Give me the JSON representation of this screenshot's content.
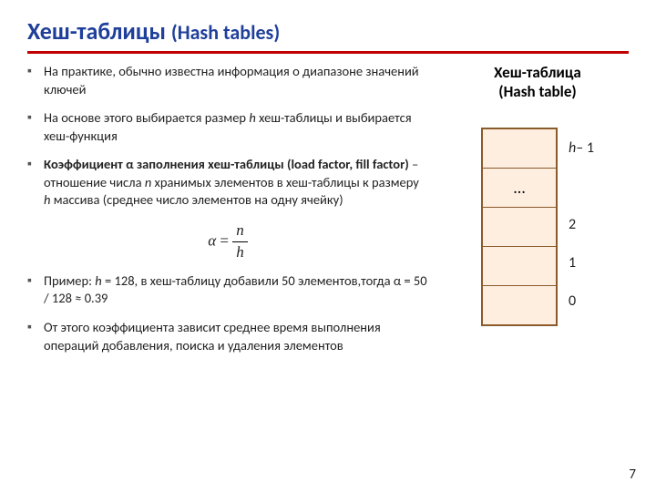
{
  "title_main": "Хеш-таблицы ",
  "title_sub": "(Hash tables)",
  "bullets": {
    "b1": "На практике, обычно известна информация о диапазоне значений ключей",
    "b2_a": "На основе этого выбирается размер ",
    "b2_h": "h",
    "b2_b": " хеш-таблицы и выбирается хеш-функция",
    "b3_bold_a": "Коэффициент ",
    "b3_bold_alpha": "α",
    "b3_bold_b": " заполнения хеш-таблицы (load factor, fill factor)",
    "b3_rest_a": " – отношение числа ",
    "b3_n": "n",
    "b3_rest_b": " хранимых элементов в хеш-таблицы к  размеру ",
    "b3_h": "h",
    "b3_rest_c": " массива (среднее число элементов на одну ячейку)",
    "b4_a": "Пример: ",
    "b4_h": "h",
    "b4_b": " = 128, в хеш-таблицу добавили 50 элементов,тогда ",
    "b4_alpha": "α",
    "b4_c": " = 50 / 128 ≈ 0.39",
    "b5": "От этого коэффициента зависит среднее время выполнения операций добавления, поиска и удаления элементов"
  },
  "formula": {
    "lhs": "α",
    "eq": " = ",
    "num": "n",
    "den": "h"
  },
  "right": {
    "title_1": "Хеш-таблица",
    "title_2": "(Hash table)",
    "ellipsis": "…",
    "lbl_top_a": "h",
    "lbl_top_b": " – 1",
    "lbl_2": "2",
    "lbl_1": "1",
    "lbl_0": "0"
  },
  "pagenum": "7"
}
